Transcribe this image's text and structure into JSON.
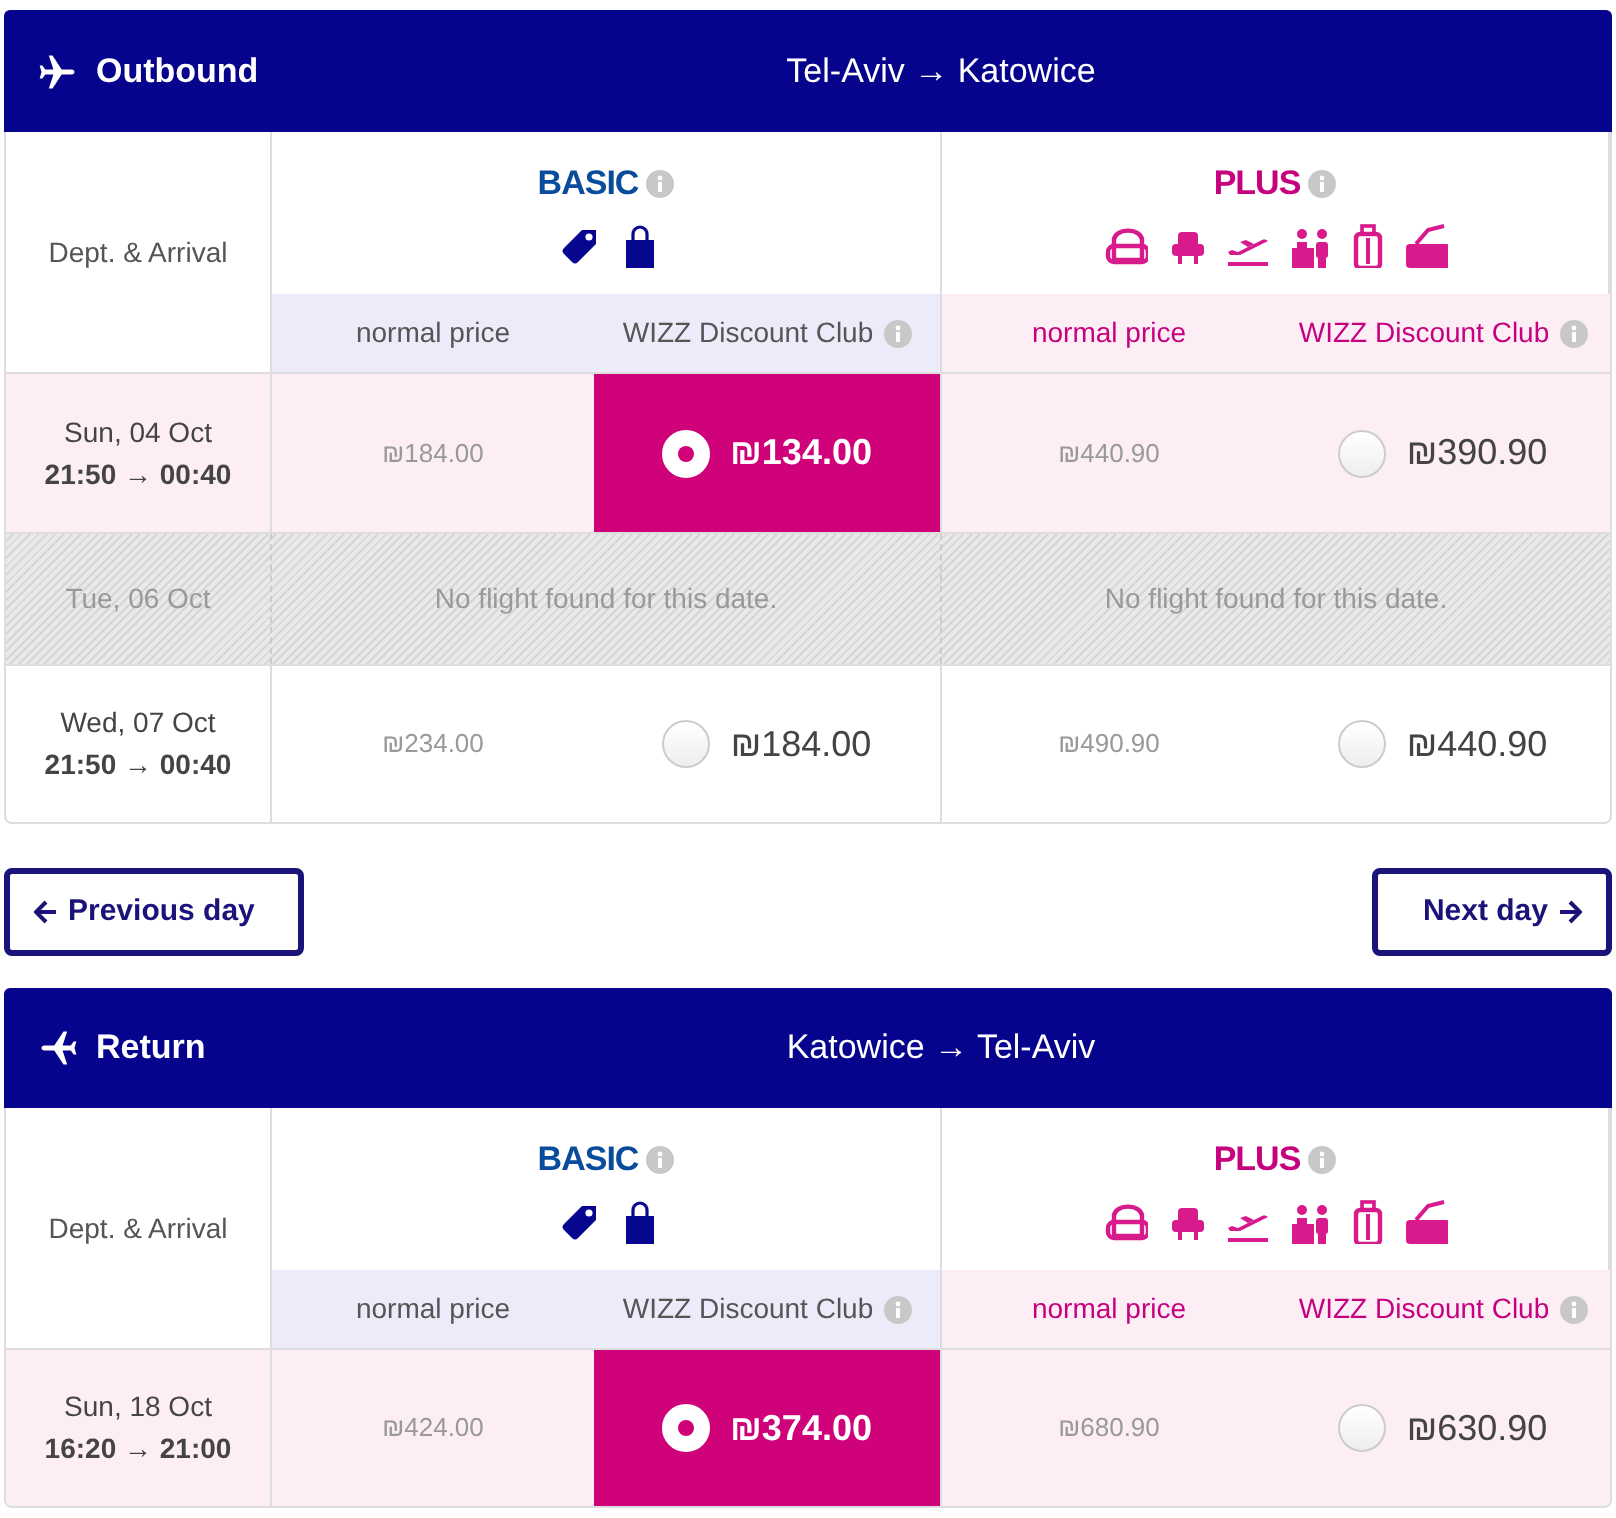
{
  "sections": [
    {
      "kind": "outbound",
      "title": "Outbound",
      "route": "Tel-Aviv → Katowice",
      "column_header": "Dept. & Arrival",
      "fares": [
        {
          "kind": "basic",
          "name": "BASIC",
          "normal_label": "normal price",
          "club_label": "WIZZ Discount Club"
        },
        {
          "kind": "plus",
          "name": "PLUS",
          "normal_label": "normal price",
          "club_label": "WIZZ Discount Club"
        }
      ],
      "rows": [
        {
          "kind": "flight",
          "date": "Sun, 04 Oct",
          "times": "21:50 → 00:40",
          "prices": [
            {
              "normal": "₪184.00",
              "club": "₪134.00",
              "selected": true
            },
            {
              "normal": "₪440.90",
              "club": "₪390.90",
              "selected": false
            }
          ]
        },
        {
          "kind": "none",
          "date": "Tue, 06 Oct",
          "messages": [
            "No flight found for this date.",
            "No flight found for this date."
          ]
        },
        {
          "kind": "flight",
          "date": "Wed, 07 Oct",
          "times": "21:50 → 00:40",
          "prices": [
            {
              "normal": "₪234.00",
              "club": "₪184.00",
              "selected": false
            },
            {
              "normal": "₪490.90",
              "club": "₪440.90",
              "selected": false
            }
          ]
        }
      ]
    },
    {
      "kind": "return",
      "title": "Return",
      "route": "Katowice → Tel-Aviv",
      "column_header": "Dept. & Arrival",
      "fares": [
        {
          "kind": "basic",
          "name": "BASIC",
          "normal_label": "normal price",
          "club_label": "WIZZ Discount Club"
        },
        {
          "kind": "plus",
          "name": "PLUS",
          "normal_label": "normal price",
          "club_label": "WIZZ Discount Club"
        }
      ],
      "rows": [
        {
          "kind": "flight",
          "date": "Sun, 18 Oct",
          "times": "16:20 → 21:00",
          "prices": [
            {
              "normal": "₪424.00",
              "club": "₪374.00",
              "selected": true
            },
            {
              "normal": "₪680.90",
              "club": "₪630.90",
              "selected": false
            }
          ]
        }
      ]
    }
  ],
  "nav": {
    "previous": "Previous day",
    "next": "Next day"
  }
}
